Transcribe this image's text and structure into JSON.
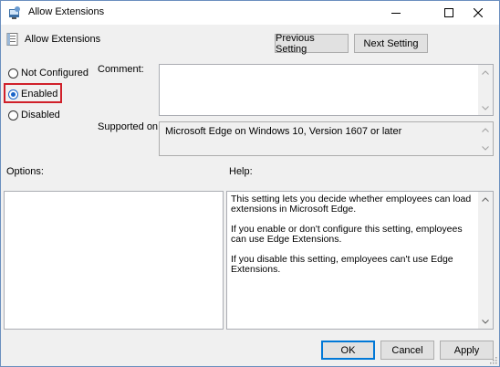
{
  "window": {
    "title": "Allow Extensions",
    "icons": {
      "app": "group-policy-icon",
      "minimize": "minimize-icon",
      "maximize": "maximize-icon",
      "close": "close-icon"
    }
  },
  "header": {
    "policy_name": "Allow Extensions",
    "policy_icon": "policy-setting-icon",
    "previous_label": "Previous Setting",
    "next_label": "Next Setting"
  },
  "state": {
    "options": [
      {
        "label": "Not Configured",
        "selected": false
      },
      {
        "label": "Enabled",
        "selected": true
      },
      {
        "label": "Disabled",
        "selected": false
      }
    ]
  },
  "comment": {
    "label": "Comment:",
    "value": ""
  },
  "supported": {
    "label": "Supported on:",
    "value": "Microsoft Edge on Windows 10, Version 1607 or later"
  },
  "options_panel": {
    "label": "Options:"
  },
  "help": {
    "label": "Help:",
    "paragraphs": [
      "This setting lets you decide whether employees can load extensions in Microsoft Edge.",
      "If you enable or don't configure this setting, employees can use Edge Extensions.",
      "If you disable this setting, employees can't use Edge Extensions."
    ]
  },
  "footer": {
    "ok_label": "OK",
    "cancel_label": "Cancel",
    "apply_label": "Apply"
  },
  "colors": {
    "accent": "#0078d7",
    "highlight": "#d0202a",
    "radio_selected": "#1a64c8"
  }
}
